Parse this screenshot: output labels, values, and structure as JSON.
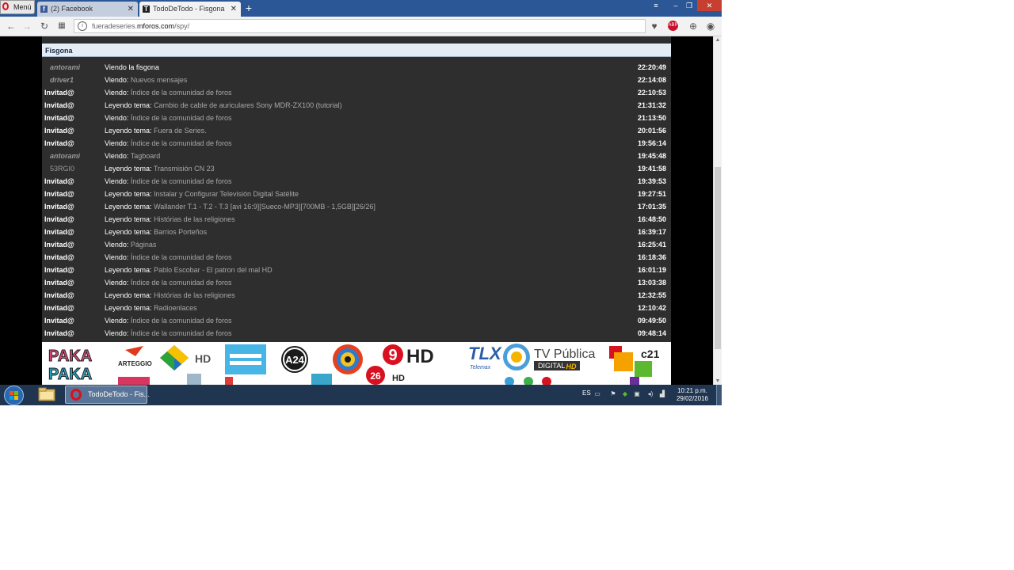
{
  "browser": {
    "menu_label": "Menú",
    "tabs": [
      {
        "title": "(2) Facebook",
        "active": false
      },
      {
        "title": "TodoDeTodo - Fisgona",
        "active": true
      }
    ],
    "new_tab": "+",
    "url_prefix": "fueradeseries.",
    "url_domain": "mforos.com",
    "url_path": "/spy/"
  },
  "panel": {
    "title": "Fisgona",
    "rows": [
      {
        "user": "antorami",
        "kind": "member",
        "action": "Viendo la fisgona",
        "target": "",
        "time": "22:20:49"
      },
      {
        "user": "driver1",
        "kind": "member",
        "action": "Viendo:",
        "target": "Nuevos mensajes",
        "time": "22:14:08"
      },
      {
        "user": "Invitad@",
        "kind": "guest",
        "action": "Viendo:",
        "target": "Índice de la comunidad de foros",
        "time": "22:10:53"
      },
      {
        "user": "Invitad@",
        "kind": "guest",
        "action": "Leyendo tema:",
        "target": "Cambio de cable de auriculares Sony MDR-ZX100 (tutorial)",
        "time": "21:31:32"
      },
      {
        "user": "Invitad@",
        "kind": "guest",
        "action": "Viendo:",
        "target": "Índice de la comunidad de foros",
        "time": "21:13:50"
      },
      {
        "user": "Invitad@",
        "kind": "guest",
        "action": "Leyendo tema:",
        "target": "Fuera de Series.",
        "time": "20:01:56"
      },
      {
        "user": "Invitad@",
        "kind": "guest",
        "action": "Viendo:",
        "target": "Índice de la comunidad de foros",
        "time": "19:56:14"
      },
      {
        "user": "antorami",
        "kind": "member",
        "action": "Viendo:",
        "target": "Tagboard",
        "time": "19:45:48"
      },
      {
        "user": "53RGI0",
        "kind": "plain",
        "action": "Leyendo tema:",
        "target": "Transmisión CN 23",
        "time": "19:41:58"
      },
      {
        "user": "Invitad@",
        "kind": "guest",
        "action": "Viendo:",
        "target": "Índice de la comunidad de foros",
        "time": "19:39:53"
      },
      {
        "user": "Invitad@",
        "kind": "guest",
        "action": "Leyendo tema:",
        "target": "Instalar y Configurar Televisión Digital Satélite",
        "time": "19:27:51"
      },
      {
        "user": "Invitad@",
        "kind": "guest",
        "action": "Leyendo tema:",
        "target": "Wallander T.1 - T.2 - T.3 [avi 16:9][Sueco-MP3][700MB - 1,5GB][26/26]",
        "time": "17:01:35"
      },
      {
        "user": "Invitad@",
        "kind": "guest",
        "action": "Leyendo tema:",
        "target": "Histórias de las religiones",
        "time": "16:48:50"
      },
      {
        "user": "Invitad@",
        "kind": "guest",
        "action": "Leyendo tema:",
        "target": "Barrios Porteños",
        "time": "16:39:17"
      },
      {
        "user": "Invitad@",
        "kind": "guest",
        "action": "Viendo:",
        "target": "Páginas",
        "time": "16:25:41"
      },
      {
        "user": "Invitad@",
        "kind": "guest",
        "action": "Viendo:",
        "target": "Índice de la comunidad de foros",
        "time": "16:18:36"
      },
      {
        "user": "Invitad@",
        "kind": "guest",
        "action": "Leyendo tema:",
        "target": "Pablo Escobar - El patron del mal HD",
        "time": "16:01:19"
      },
      {
        "user": "Invitad@",
        "kind": "guest",
        "action": "Viendo:",
        "target": "Índice de la comunidad de foros",
        "time": "13:03:38"
      },
      {
        "user": "Invitad@",
        "kind": "guest",
        "action": "Leyendo tema:",
        "target": "Histórias de las religiones",
        "time": "12:32:55"
      },
      {
        "user": "Invitad@",
        "kind": "guest",
        "action": "Leyendo tema:",
        "target": "Radioenlaces",
        "time": "12:10:42"
      },
      {
        "user": "Invitad@",
        "kind": "guest",
        "action": "Viendo:",
        "target": "Índice de la comunidad de foros",
        "time": "09:49:50"
      },
      {
        "user": "Invitad@",
        "kind": "guest",
        "action": "Viendo:",
        "target": "Índice de la comunidad de foros",
        "time": "09:48:14"
      }
    ]
  },
  "banner": {
    "paka1": "PAKA",
    "paka2": "PAKA",
    "arteggio": "ARTEGGIO",
    "hd1": "HD",
    "a24": "A24",
    "nine": "9",
    "nine_hd": "HD",
    "n26": "26",
    "n26_hd": "HD",
    "tlx": "TLX",
    "tlx_sub": "Telemax",
    "tvp": "TV Pública",
    "tvp_sub": "DIGITAL",
    "tvp_hd": "HD",
    "c21": "c21"
  },
  "taskbar": {
    "task_label": "TodoDeTodo - Fis...",
    "lang": "ES",
    "time": "10:21 p.m.",
    "date": "29/02/2016"
  }
}
